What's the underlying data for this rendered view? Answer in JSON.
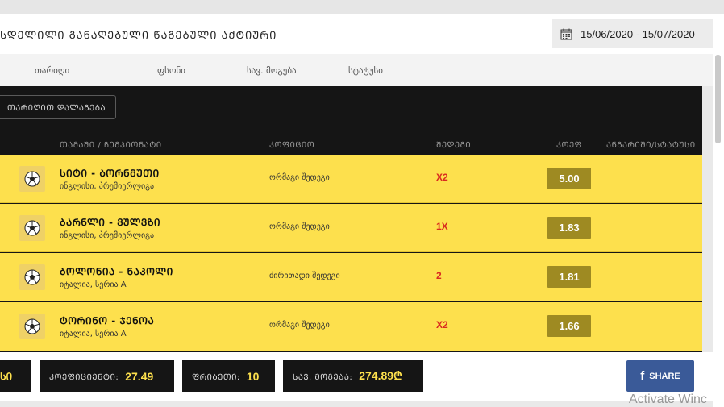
{
  "header": {
    "title": "ᲡᲓᲔᲚᲘᲚᲘ ᲒᲐᲜᲐᲦᲔᲑᲣᲚᲘ ᲬᲐᲒᲔᲑᲣᲚᲘ ᲐᲥᲢᲘᲣᲠᲘ",
    "date_range": "15/06/2020 - 15/07/2020",
    "calendar_icon": "calendar-icon"
  },
  "columns": [
    "თარიღი",
    "ფსონი",
    "სავ. მოგება",
    "სტატუსი"
  ],
  "sort_button": "ᲗᲐᲠᲘᲦᲘᲗ ᲓᲐᲚᲐᲒᲔᲑᲐ",
  "table": {
    "headers": {
      "match": "ᲗᲐᲛᲐᲨᲘ / ᲩᲔᲛᲞᲘᲝᲜᲐᲢᲘ",
      "market": "ᲙᲝᲤᲘᲪᲘᲝ",
      "outcome": "ᲨᲔᲓᲔᲒᲘ",
      "coef": "ᲙᲝᲔᲤ",
      "status": "ᲐᲜᲒᲐᲠᲘᲨᲘ/ᲡᲢᲐᲢᲣᲡᲘ"
    },
    "rows": [
      {
        "match": "ᲡᲘᲢᲘ - ᲑᲝᲠᲜᲛᲣᲗᲘ",
        "league": "ინგლისი, პრემიერლიგა",
        "market": "ორმაგი შედეგი",
        "outcome": "X2",
        "coef": "5.00"
      },
      {
        "match": "ᲑᲐᲠᲜᲚᲘ - ᲕᲣᲚᲕᲖᲘ",
        "league": "ინგლისი, პრემიერლიგა",
        "market": "ორმაგი შედეგი",
        "outcome": "1X",
        "coef": "1.83"
      },
      {
        "match": "ᲑᲝᲚᲝᲜᲘᲐ - ᲜᲐᲞᲝᲚᲘ",
        "league": "იტალია, სერია A",
        "market": "ძირითადი შედეგი",
        "outcome": "2",
        "coef": "1.81"
      },
      {
        "match": "ᲢᲝᲠᲘᲜᲝ - ᲯᲔᲜᲝᲐ",
        "league": "იტალია, სერია A",
        "market": "ორმაგი შედეგი",
        "outcome": "X2",
        "coef": "1.66"
      }
    ],
    "ball_icon": "soccer-ball-icon"
  },
  "footer": {
    "first_label": "ᲡᲘ",
    "coef_label": "ᲙᲝᲔᲤᲘᲪᲘᲔᲜᲢᲘ:",
    "coef_value": "27.49",
    "stake_label": "ᲤᲠᲘᲑᲔᲗᲘ:",
    "stake_value": "10",
    "payout_label": "ᲡᲐᲕ. ᲛᲝᲒᲔᲑᲐ:",
    "payout_value": "274.89₾",
    "share_label": "SHARE",
    "share_icon": "facebook-icon"
  },
  "watermark": "Activate Winc",
  "colors": {
    "accent_yellow": "#fde04d",
    "coef_badge": "#9e8a22",
    "outcome_red": "#d92b1f",
    "facebook_blue": "#3a5a98",
    "dark_panel": "#151515"
  }
}
